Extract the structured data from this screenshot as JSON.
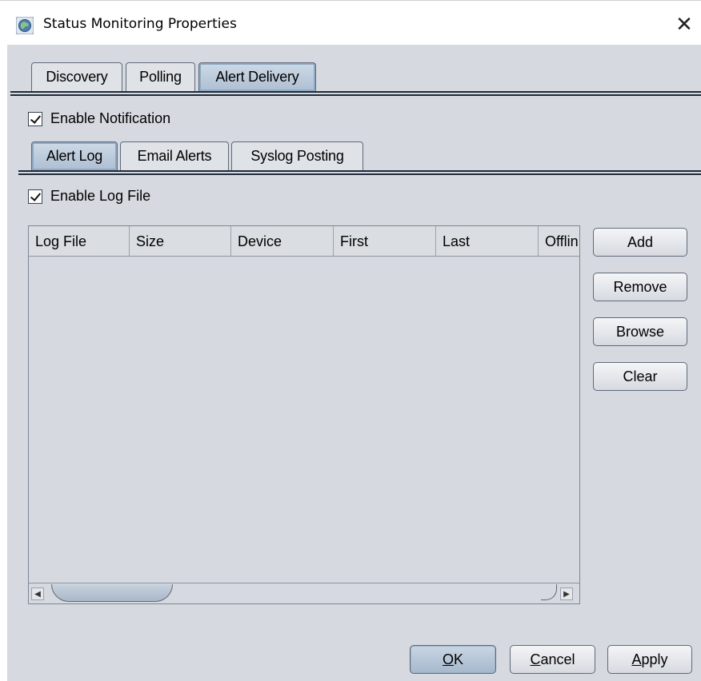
{
  "window": {
    "title": "Status Monitoring Properties",
    "close_glyph": "✕"
  },
  "main_tabs": [
    {
      "label": "Discovery",
      "active": false
    },
    {
      "label": "Polling",
      "active": false
    },
    {
      "label": "Alert Delivery",
      "active": true
    }
  ],
  "enable_notification": {
    "label": "Enable Notification",
    "checked": true
  },
  "sub_tabs": [
    {
      "label": "Alert Log",
      "active": true
    },
    {
      "label": "Email Alerts",
      "active": false
    },
    {
      "label": "Syslog Posting",
      "active": false
    }
  ],
  "enable_log_file": {
    "label": "Enable Log File",
    "checked": true
  },
  "log_table": {
    "columns": [
      "Log File",
      "Size",
      "Device",
      "First",
      "Last",
      "Offlin"
    ],
    "rows": []
  },
  "side_buttons": {
    "add": "Add",
    "remove": "Remove",
    "browse": "Browse",
    "clear": "Clear"
  },
  "footer": {
    "ok": {
      "mnemonic": "O",
      "rest": "K"
    },
    "cancel": {
      "mnemonic": "C",
      "rest": "ancel"
    },
    "apply": {
      "mnemonic": "A",
      "rest": "pply"
    }
  },
  "colors": {
    "panel": "#d6d9df",
    "active_tab": "#b8c8da",
    "border": "#5d6a7a"
  }
}
